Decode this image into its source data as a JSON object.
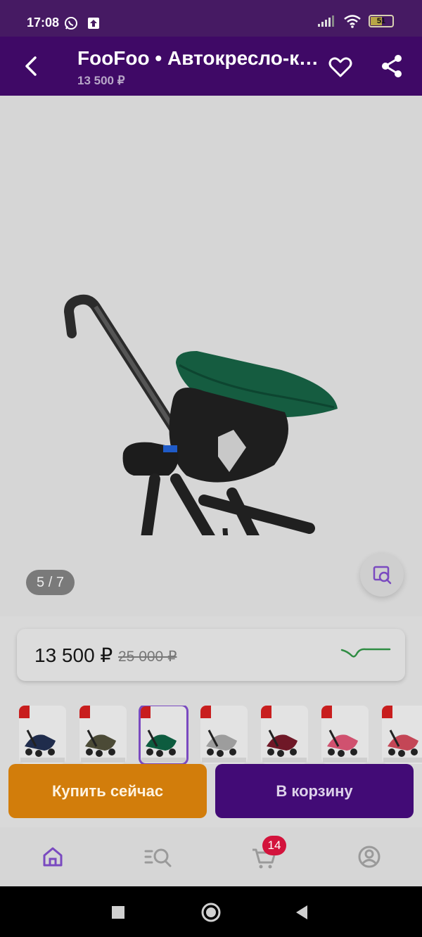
{
  "status_bar": {
    "time": "17:08",
    "battery": "51"
  },
  "app_bar": {
    "title": "FooFoo • Автокресло-коляска",
    "subtitle": "13 500 ₽"
  },
  "gallery": {
    "counter": "5 / 7"
  },
  "price_card": {
    "current": "13 500 ₽",
    "old": "25 000 ₽"
  },
  "thumbnails": [
    {
      "canopy_color": "#1f2c4c"
    },
    {
      "canopy_color": "#4b4a36"
    },
    {
      "canopy_color": "#0d5c3f"
    },
    {
      "canopy_color": "#9d9d9d"
    },
    {
      "canopy_color": "#6f1827"
    },
    {
      "canopy_color": "#d0516f"
    },
    {
      "canopy_color": "#c44656"
    }
  ],
  "actions": {
    "buy_now": "Купить сейчас",
    "add_to_cart": "В корзину"
  },
  "tabbar": {
    "cart_count": "14"
  },
  "colors": {
    "app_bar": "#3f0966",
    "buy_now": "#d27d0b",
    "cart_button": "#420b76",
    "trend_line": "#2f8d43",
    "accent": "#7a4ac0"
  }
}
